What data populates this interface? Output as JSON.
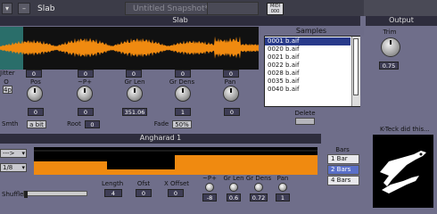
{
  "window": {
    "title": "Slab",
    "snapshot_placeholder": "Untitled Snapshot*",
    "midi_label": "MIDI",
    "midi_value": "000"
  },
  "slab": {
    "header": "Slab",
    "labels": {
      "jitter": "Jitter",
      "o": "O",
      "pos": "Pos",
      "pitch": "~P+",
      "gr_len": "Gr Len",
      "gr_dens": "Gr Dens",
      "pan": "Pan",
      "smth": "Smth",
      "root": "Root",
      "fade": "Fade"
    },
    "values": {
      "jitter": "0",
      "top_pos": "0",
      "top_pitch": "0",
      "top_gr_len": "0",
      "top_gr_dens": "0",
      "top_pan": "0",
      "o": "4p",
      "pos": "0",
      "pitch": "0",
      "gr_len": "351.06",
      "gr_dens": "1",
      "pan": "0",
      "smth": "a bit",
      "root": "0",
      "fade": "50%"
    }
  },
  "samples": {
    "header": "Samples",
    "items": [
      "0001 b.aif",
      "0020 b.aif",
      "0021 b.aif",
      "0022 b.aif",
      "0028 b.aif",
      "0035 b.aif",
      "0040 b.aif"
    ],
    "selected_index": 0,
    "delete_label": "Delete"
  },
  "output": {
    "header": "Output",
    "trim_label": "Trim",
    "trim_value": "0.75",
    "credit": "K-Teck did this..."
  },
  "angharad": {
    "header": "Angharad 1",
    "mode_value": "--->",
    "div_value": "1/8",
    "shuffle_label": "Shuffle",
    "labels": {
      "length": "Length",
      "ofst": "Ofst",
      "x_offset": "X Offset",
      "pitch": "~P+",
      "gr_len": "Gr Len",
      "gr_dens": "Gr Dens",
      "pan": "Pan"
    },
    "values": {
      "length": "4",
      "ofst": "0",
      "x_offset": "0",
      "pitch": "-8",
      "gr_len": "0.6",
      "gr_dens": "0.72",
      "pan": "1"
    },
    "bars_label": "Bars",
    "bars": [
      "1 Bar",
      "2 Bars",
      "4 Bars"
    ],
    "bars_selected": 1
  },
  "colors": {
    "accent": "#f08a10",
    "background": "#6f6e8a",
    "header": "#2e2d3d",
    "list_selected": "#283a8a"
  }
}
